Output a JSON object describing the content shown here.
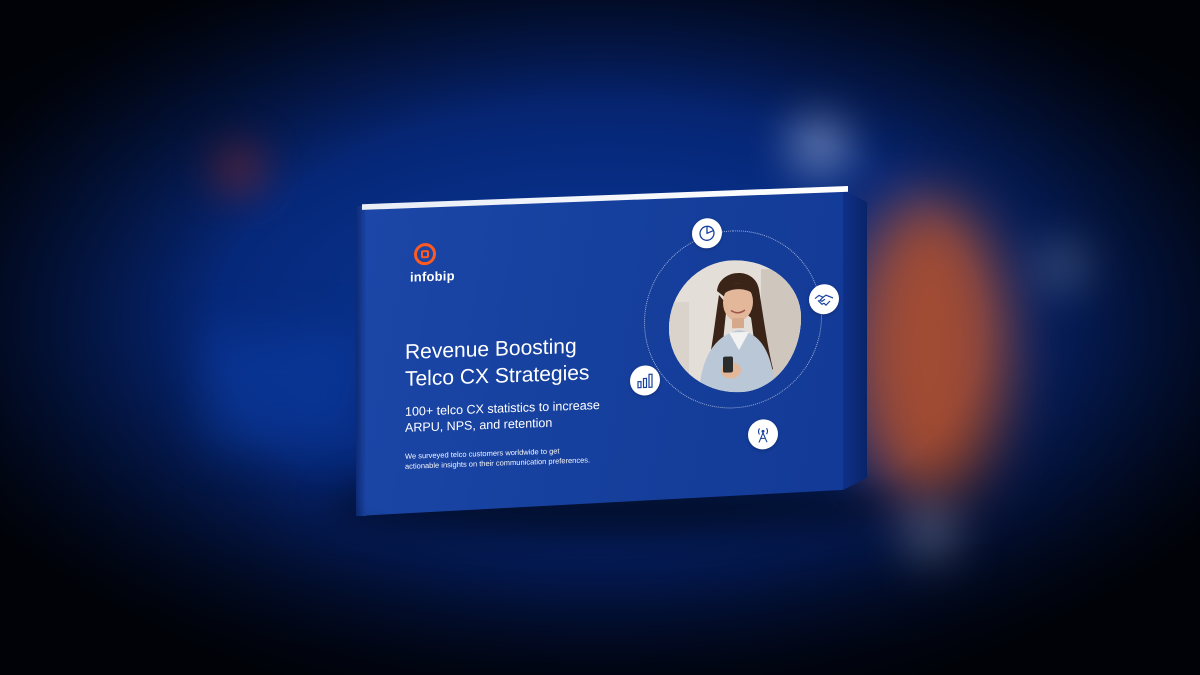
{
  "brand": {
    "name": "infobip",
    "logo_color": "#ff5a1f"
  },
  "cover": {
    "title_line1": "Revenue Boosting",
    "title_line2": "Telco CX Strategies",
    "subtitle_line1": "100+ telco CX statistics to increase",
    "subtitle_line2": "ARPU, NPS, and retention",
    "description_line1": "We surveyed telco customers worldwide to get",
    "description_line2": "actionable insights on their communication preferences.",
    "background_color": "#17419f"
  },
  "icons": [
    {
      "name": "pie-chart-icon"
    },
    {
      "name": "handshake-icon"
    },
    {
      "name": "bar-chart-icon"
    },
    {
      "name": "cell-tower-icon"
    }
  ]
}
